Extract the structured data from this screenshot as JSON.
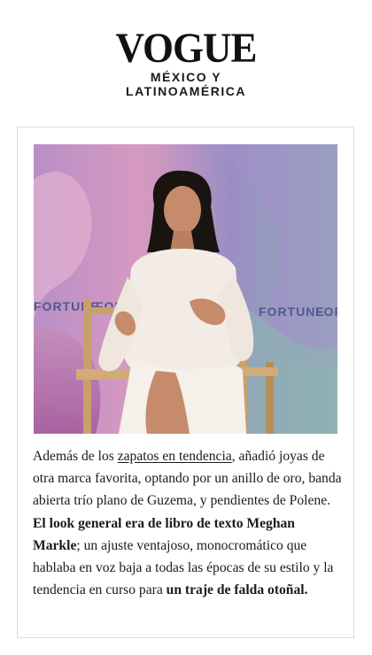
{
  "masthead": {
    "logo": "VOGUE",
    "edition_line1": "MÉXICO Y",
    "edition_line2": "LATINOAMÉRICA"
  },
  "photo": {
    "backdrop_texts": [
      "FORTUNE",
      "FORT",
      "FORTUNE",
      "FORT"
    ]
  },
  "article": {
    "t1": "Además de los ",
    "link": "zapatos en tendencia",
    "t2": ", añadió joyas de otra marca favorita, optando por un anillo de oro, banda abierta trío plano de Guzema, y pendientes de Polene. ",
    "b1": "El look general era de libro de texto Meghan Markle",
    "t3": "; un ajuste ventajoso, monocromático que hablaba en voz baja a todas las épocas de su estilo y la tendencia en curso para ",
    "b2": "un traje de falda otoñal."
  },
  "colors": {
    "backdrop_blue": "#8fa7b4",
    "backdrop_pink": "#d98fb5",
    "backdrop_purple": "#8a77b8",
    "dress": "#f3ece6",
    "chair": "#c9a06a"
  }
}
